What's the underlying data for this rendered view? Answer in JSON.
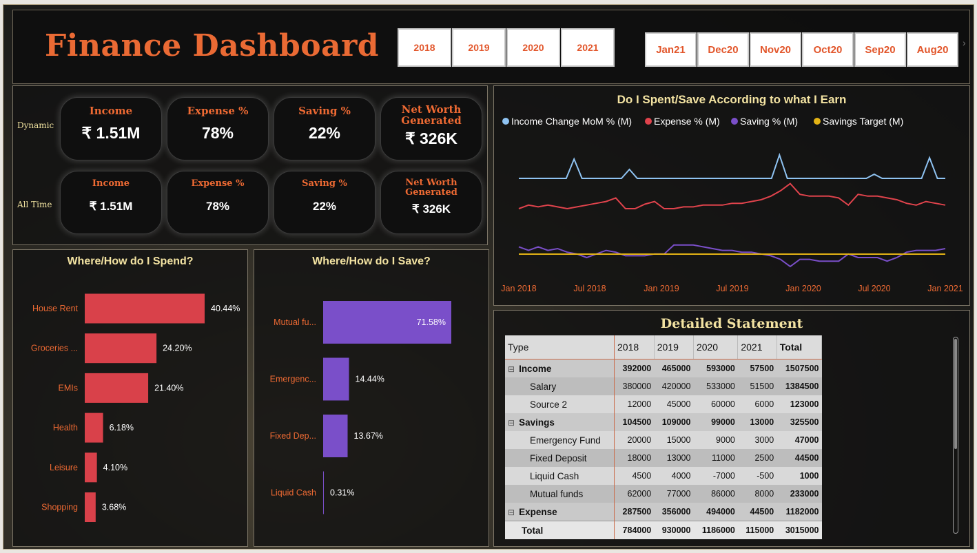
{
  "header": {
    "title": "Finance Dashboard"
  },
  "year_slicers": [
    "2018",
    "2019",
    "2020",
    "2021"
  ],
  "month_slicers": [
    "Jan21",
    "Dec20",
    "Nov20",
    "Oct20",
    "Sep20",
    "Aug20"
  ],
  "kpis": {
    "dynamic_label": "Dynamic",
    "alltime_label": "All Time",
    "dynamic": [
      {
        "label": "Income",
        "value": "₹ 1.51M"
      },
      {
        "label": "Expense %",
        "value": "78%"
      },
      {
        "label": "Saving %",
        "value": "22%"
      },
      {
        "label": "Net Worth Generated",
        "value": "₹ 326K"
      }
    ],
    "alltime": [
      {
        "label": "Income",
        "value": "₹ 1.51M"
      },
      {
        "label": "Expense %",
        "value": "78%"
      },
      {
        "label": "Saving %",
        "value": "22%"
      },
      {
        "label": "Net Worth Generated",
        "value": "₹ 326K"
      }
    ]
  },
  "spend_chart": {
    "title": "Where/How do I Spend?",
    "chart_data": {
      "type": "bar",
      "categories": [
        "House Rent",
        "Groceries ...",
        "EMIs",
        "Health",
        "Leisure",
        "Shopping"
      ],
      "values": [
        40.44,
        24.2,
        21.4,
        6.18,
        4.1,
        3.68
      ],
      "labels": [
        "40.44%",
        "24.20%",
        "21.40%",
        "6.18%",
        "4.10%",
        "3.68%"
      ],
      "color": "#d9414a"
    }
  },
  "save_chart": {
    "title": "Where/How do I Save?",
    "chart_data": {
      "type": "bar",
      "categories": [
        "Mutual fu...",
        "Emergenc...",
        "Fixed Dep...",
        "Liquid Cash"
      ],
      "values": [
        71.58,
        14.44,
        13.67,
        0.31
      ],
      "labels": [
        "71.58%",
        "14.44%",
        "13.67%",
        "0.31%"
      ],
      "color": "#7a4fc9"
    }
  },
  "line_chart": {
    "title": "Do I Spent/Save According to what I Earn",
    "chart_data": {
      "type": "line",
      "x_ticks": [
        "Jan 2018",
        "Jul 2018",
        "Jan 2019",
        "Jul 2019",
        "Jan 2020",
        "Jul 2020",
        "Jan 2021"
      ],
      "series": [
        {
          "name": "Income Change MoM % (M)",
          "color": "#8fc3f2",
          "values": [
            0,
            0,
            0,
            0,
            0,
            0,
            0,
            28,
            0,
            0,
            0,
            0,
            0,
            0,
            13,
            0,
            0,
            0,
            0,
            0,
            0,
            0,
            0,
            0,
            0,
            0,
            0,
            0,
            0,
            0,
            0,
            0,
            0,
            34,
            0,
            0,
            0,
            0,
            0,
            0,
            0,
            0,
            0,
            0,
            0,
            6,
            0,
            0,
            0,
            0,
            0,
            0,
            30,
            0,
            0
          ]
        },
        {
          "name": "Expense % (M)",
          "color": "#e0434c",
          "values": [
            0,
            4,
            2,
            4,
            2,
            0,
            2,
            4,
            6,
            8,
            12,
            0,
            0,
            5,
            8,
            0,
            0,
            2,
            2,
            4,
            4,
            4,
            6,
            6,
            8,
            10,
            14,
            20,
            28,
            16,
            14,
            14,
            14,
            12,
            4,
            16,
            14,
            14,
            12,
            10,
            6,
            4,
            8,
            6,
            4
          ]
        },
        {
          "name": "Saving % (M)",
          "color": "#7a4fc9",
          "values": [
            2,
            -2,
            2,
            -2,
            0,
            -4,
            -6,
            -10,
            -6,
            -2,
            -4,
            -8,
            -8,
            -8,
            -6,
            -6,
            4,
            4,
            4,
            2,
            0,
            -2,
            -2,
            -4,
            -4,
            -6,
            -8,
            -12,
            -20,
            -12,
            -12,
            -14,
            -14,
            -14,
            -6,
            -10,
            -10,
            -10,
            -14,
            -10,
            -4,
            -2,
            -2,
            -2,
            0
          ]
        },
        {
          "name": "Savings Target (M)",
          "color": "#e3b315",
          "values": [
            -12,
            -12
          ]
        }
      ]
    }
  },
  "statement": {
    "title": "Detailed Statement",
    "columns": [
      "Type",
      "2018",
      "2019",
      "2020",
      "2021",
      "Total"
    ],
    "rows": [
      {
        "kind": "grp",
        "toggle": "⊟",
        "label": "Income",
        "v": [
          "392000",
          "465000",
          "593000",
          "57500",
          "1507500"
        ]
      },
      {
        "kind": "sub",
        "label": "Salary",
        "v": [
          "380000",
          "420000",
          "533000",
          "51500",
          "1384500"
        ]
      },
      {
        "kind": "sub",
        "label": "Source 2",
        "v": [
          "12000",
          "45000",
          "60000",
          "6000",
          "123000"
        ]
      },
      {
        "kind": "grp",
        "toggle": "⊟",
        "label": "Savings",
        "v": [
          "104500",
          "109000",
          "99000",
          "13000",
          "325500"
        ]
      },
      {
        "kind": "sub",
        "label": "Emergency Fund",
        "v": [
          "20000",
          "15000",
          "9000",
          "3000",
          "47000"
        ]
      },
      {
        "kind": "sub",
        "label": "Fixed Deposit",
        "v": [
          "18000",
          "13000",
          "11000",
          "2500",
          "44500"
        ]
      },
      {
        "kind": "sub",
        "label": "Liquid Cash",
        "v": [
          "4500",
          "4000",
          "-7000",
          "-500",
          "1000"
        ]
      },
      {
        "kind": "sub",
        "label": "Mutual funds",
        "v": [
          "62000",
          "77000",
          "86000",
          "8000",
          "233000"
        ]
      },
      {
        "kind": "grp",
        "toggle": "⊟",
        "label": "Expense",
        "v": [
          "287500",
          "356000",
          "494000",
          "44500",
          "1182000"
        ]
      }
    ],
    "total": {
      "label": "Total",
      "v": [
        "784000",
        "930000",
        "1186000",
        "115000",
        "3015000"
      ]
    }
  }
}
